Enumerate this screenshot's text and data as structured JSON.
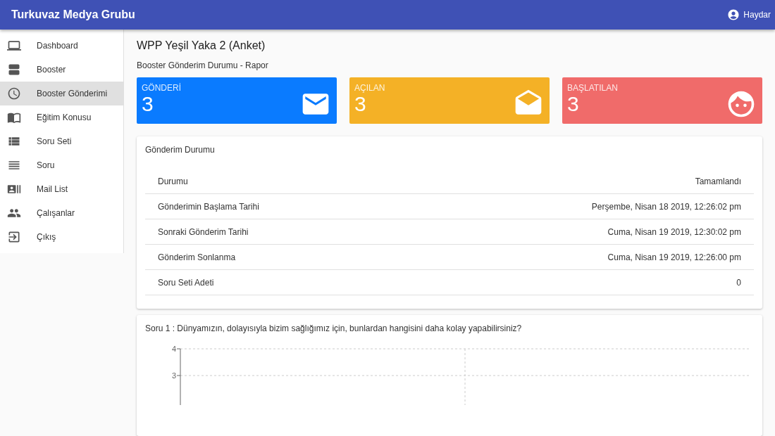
{
  "app_bar": {
    "title": "Turkuvaz Medya Grubu",
    "user": "Haydar"
  },
  "sidebar": {
    "items": [
      {
        "kind": "laptop",
        "label": "Dashboard",
        "selected": false
      },
      {
        "kind": "agenda",
        "label": "Booster",
        "selected": false
      },
      {
        "kind": "clock",
        "label": "Booster Gönderimi",
        "selected": true
      },
      {
        "kind": "book",
        "label": "Eğitim Konusu",
        "selected": false
      },
      {
        "kind": "list",
        "label": "Soru Seti",
        "selected": false
      },
      {
        "kind": "lines",
        "label": "Soru",
        "selected": false
      },
      {
        "kind": "contacts",
        "label": "Mail List",
        "selected": false
      },
      {
        "kind": "people",
        "label": "Çalışanlar",
        "selected": false
      },
      {
        "kind": "exit",
        "label": "Çıkış",
        "selected": false
      }
    ]
  },
  "page": {
    "title": "WPP Yeşil Yaka 2 (Anket)",
    "subtitle": "Booster Gönderim Durumu - Rapor"
  },
  "stats": [
    {
      "kind": "mail",
      "label": "GÖNDERİ",
      "value": "3",
      "color": "#0a7bff"
    },
    {
      "kind": "open-mail",
      "label": "AÇILAN",
      "value": "3",
      "color": "#f4b126"
    },
    {
      "kind": "face",
      "label": "BAŞLATILAN",
      "value": "3",
      "color": "#f06b6a"
    }
  ],
  "status_panel": {
    "title": "Gönderim Durumu",
    "rows": [
      {
        "label": "Durumu",
        "value": "Tamamlandı"
      },
      {
        "label": "Gönderimin Başlama Tarihi",
        "value": "Perşembe, Nisan 18 2019, 12:26:02 pm"
      },
      {
        "label": "Sonraki Gönderim Tarihi",
        "value": "Cuma, Nisan 19 2019, 12:30:02 pm"
      },
      {
        "label": "Gönderim Sonlanma",
        "value": "Cuma, Nisan 19 2019, 12:26:00 pm"
      },
      {
        "label": "Soru Seti Adeti",
        "value": "0"
      }
    ]
  },
  "question_panel": {
    "title": "Soru 1 : Dünyamızın, dolayısıyla bizim sağlığımız için, bunlardan hangisini daha kolay yapabilirsiniz?",
    "axis_labels": [
      "4",
      "3"
    ]
  }
}
